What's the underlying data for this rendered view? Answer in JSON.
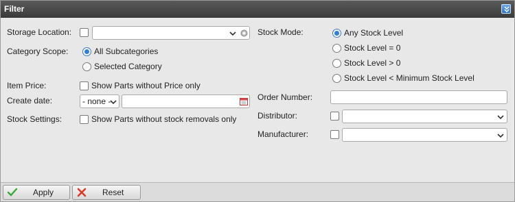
{
  "panel": {
    "title": "Filter"
  },
  "left": {
    "storage_location_label": "Storage Location:",
    "category_scope_label": "Category Scope:",
    "scope_all": "All Subcategories",
    "scope_selected": "Selected Category",
    "item_price_label": "Item Price:",
    "item_price_option": "Show Parts without Price only",
    "create_date_label": "Create date:",
    "create_date_mode": "- none -",
    "stock_settings_label": "Stock Settings:",
    "stock_settings_option": "Show Parts without stock removals only"
  },
  "right": {
    "stock_mode_label": "Stock Mode:",
    "stock_modes": [
      "Any Stock Level",
      "Stock Level = 0",
      "Stock Level > 0",
      "Stock Level < Minimum Stock Level"
    ],
    "order_number_label": "Order Number:",
    "distributor_label": "Distributor:",
    "manufacturer_label": "Manufacturer:"
  },
  "buttons": {
    "apply": "Apply",
    "reset": "Reset"
  },
  "colors": {
    "titlebar": "#404040",
    "accent": "#2f7fd6",
    "apply_icon": "#3aa83a",
    "reset_icon": "#d63a2a"
  }
}
